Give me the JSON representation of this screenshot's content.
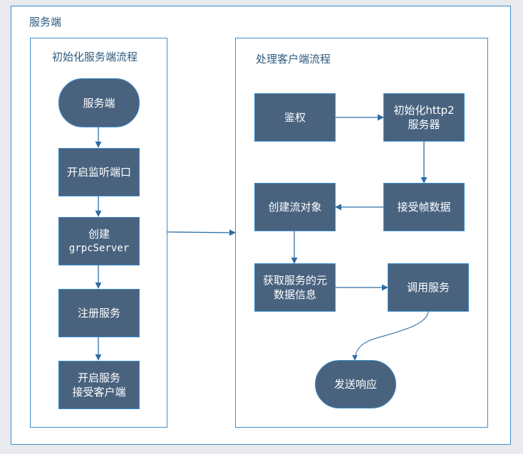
{
  "outer": {
    "title": "服务端"
  },
  "left_panel": {
    "title": "初始化服务端流程",
    "nodes": [
      {
        "id": "server",
        "line1": "服务端",
        "line2": ""
      },
      {
        "id": "listen",
        "line1": "开启监听端口",
        "line2": ""
      },
      {
        "id": "create",
        "line1": "创建",
        "line2": "grpcServer"
      },
      {
        "id": "register",
        "line1": "注册服务",
        "line2": ""
      },
      {
        "id": "start",
        "line1": "开启服务",
        "line2": "接受客户端"
      }
    ]
  },
  "right_panel": {
    "title": "处理客户端流程",
    "nodes": [
      {
        "id": "auth",
        "line1": "鉴权",
        "line2": ""
      },
      {
        "id": "init_http2",
        "line1": "初始化http2",
        "line2": "服务器"
      },
      {
        "id": "recv_frame",
        "line1": "接受帧数据",
        "line2": ""
      },
      {
        "id": "create_stream",
        "line1": "创建流对象",
        "line2": ""
      },
      {
        "id": "get_meta",
        "line1": "获取服务的元",
        "line2": "数据信息"
      },
      {
        "id": "invoke",
        "line1": "调用服务",
        "line2": ""
      },
      {
        "id": "respond",
        "line1": "发送响应",
        "line2": ""
      }
    ]
  },
  "colors": {
    "node_fill": "#49637f",
    "border": "#3c8dcb",
    "edge": "#2e6da4",
    "title_text": "#2d5a7e"
  }
}
